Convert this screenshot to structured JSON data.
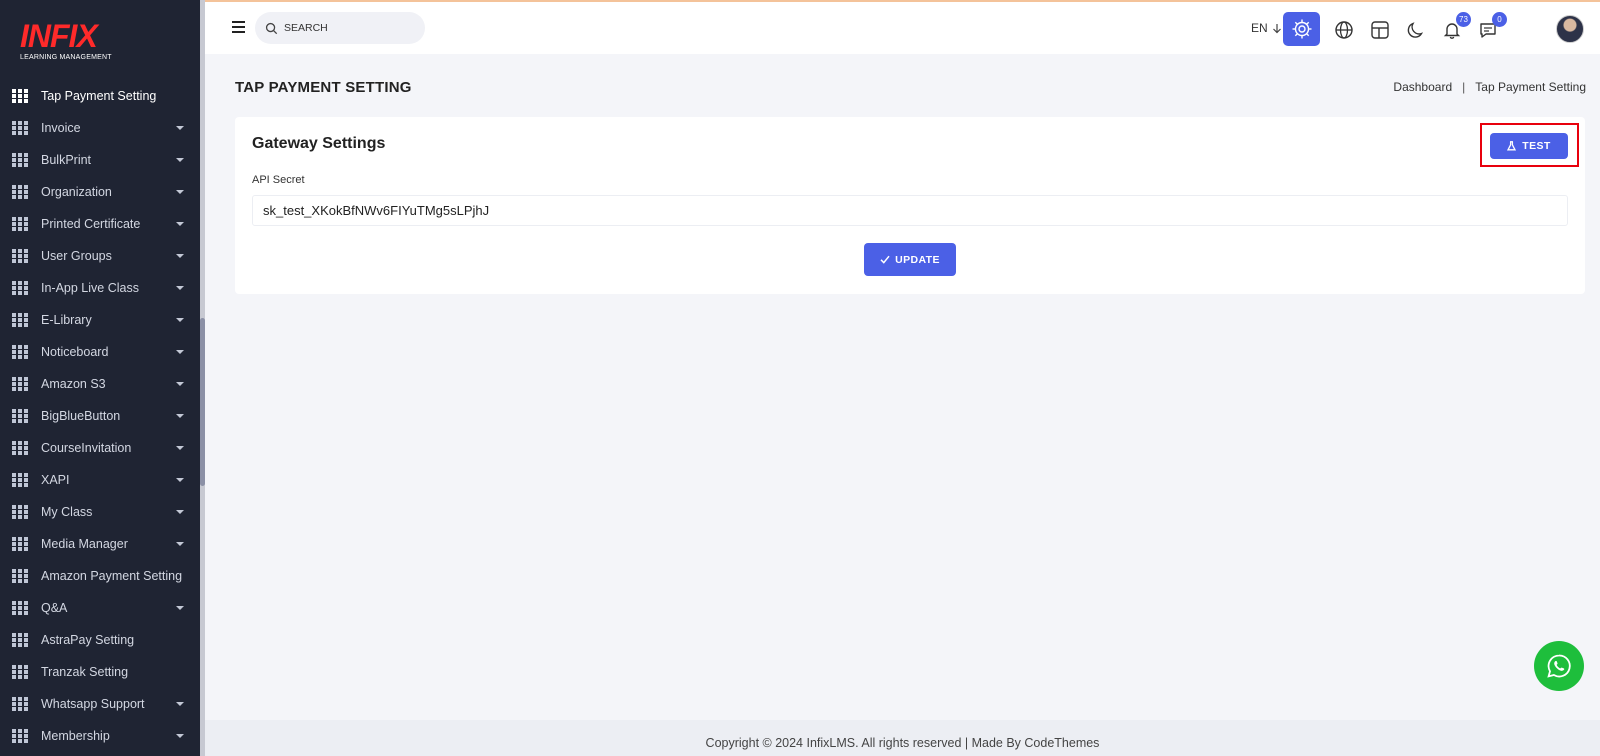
{
  "logo": {
    "word": "INFIX",
    "subtitle": "LEARNING MANAGEMENT"
  },
  "sidebar": {
    "items": [
      {
        "label": "Tap Payment Setting",
        "has_submenu": false,
        "active": true
      },
      {
        "label": "Invoice",
        "has_submenu": true
      },
      {
        "label": "BulkPrint",
        "has_submenu": true
      },
      {
        "label": "Organization",
        "has_submenu": true
      },
      {
        "label": "Printed Certificate",
        "has_submenu": true
      },
      {
        "label": "User Groups",
        "has_submenu": true
      },
      {
        "label": "In-App Live Class",
        "has_submenu": true
      },
      {
        "label": "E-Library",
        "has_submenu": true
      },
      {
        "label": "Noticeboard",
        "has_submenu": true
      },
      {
        "label": "Amazon S3",
        "has_submenu": true
      },
      {
        "label": "BigBlueButton",
        "has_submenu": true
      },
      {
        "label": "CourseInvitation",
        "has_submenu": true
      },
      {
        "label": "XAPI",
        "has_submenu": true
      },
      {
        "label": "My Class",
        "has_submenu": true
      },
      {
        "label": "Media Manager",
        "has_submenu": true
      },
      {
        "label": "Amazon Payment Setting",
        "has_submenu": false
      },
      {
        "label": "Q&A",
        "has_submenu": true
      },
      {
        "label": "AstraPay Setting",
        "has_submenu": false
      },
      {
        "label": "Tranzak Setting",
        "has_submenu": false
      },
      {
        "label": "Whatsapp Support",
        "has_submenu": true
      },
      {
        "label": "Membership",
        "has_submenu": true
      }
    ]
  },
  "topbar": {
    "search_placeholder": "SEARCH",
    "language": "EN",
    "notifications_count": "73",
    "messages_count": "0"
  },
  "page": {
    "title": "TAP PAYMENT SETTING",
    "breadcrumb": [
      "Dashboard",
      "Tap Payment Setting"
    ]
  },
  "card": {
    "title": "Gateway Settings",
    "test_label": "TEST",
    "field_label": "API Secret",
    "field_value": "sk_test_XKokBfNWv6FIYuTMg5sLPjhJ",
    "update_label": "UPDATE"
  },
  "footer": {
    "text": "Copyright © 2024 InfixLMS. All rights reserved | Made By CodeThemes"
  },
  "colors": {
    "sidebar": "#1f2433",
    "accent": "#4b60e6",
    "highlight": "#e8000d",
    "whatsapp": "#1ebe3c"
  }
}
